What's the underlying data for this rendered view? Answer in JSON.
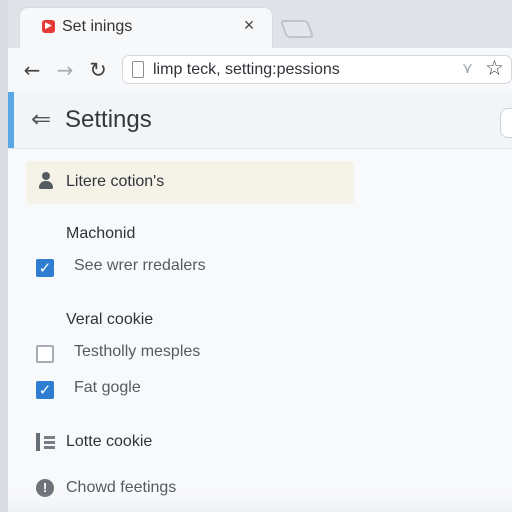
{
  "browser": {
    "tab": {
      "favicon": "youtube-play-icon",
      "title": "Set inings",
      "close_icon": "close-icon"
    },
    "new_tab_icon": "new-tab-icon",
    "toolbar": {
      "back_icon": "arrow-left-icon",
      "forward_icon": "arrow-right-icon",
      "reload_icon": "reload-icon",
      "address": "limp teck, setting:pessions",
      "address_icon": "page-icon",
      "translate_icon": "extension-icon",
      "bookmark_icon": "star-icon"
    }
  },
  "settings": {
    "back_icon": "settings-back-icon",
    "title": "Settings",
    "profile_text": "Litere cotion's",
    "sections": [
      {
        "title": "Machonid",
        "options": [
          {
            "label": "See wrer rredalers",
            "checked": true
          }
        ]
      },
      {
        "title": "Veral cookie",
        "options": [
          {
            "label": "Testholly mesples",
            "checked": false
          },
          {
            "label": "Fat gogle",
            "checked": true
          }
        ]
      }
    ],
    "items": [
      {
        "icon": "list-icon",
        "label": "Lotte cookie"
      },
      {
        "icon": "info-icon",
        "label": "Chowd feetings"
      }
    ]
  },
  "colors": {
    "accent": "#5aa7e6",
    "checkbox": "#2e7dd1",
    "favicon": "#e53935"
  }
}
